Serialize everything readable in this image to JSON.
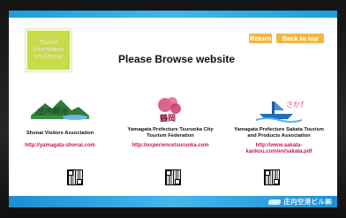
{
  "kiosk": {
    "info_label": "Tourist\nInformation\non Shonai",
    "page_title": "Please Browse website",
    "return_label": "Return",
    "back_to_top_label": "Back to top",
    "footer_text": "庄内空港ビル㈱"
  },
  "organizations": [
    {
      "logo_text": "庄内観光",
      "name": "Shonai Visitors Association",
      "url": "http://yamagata-shonai.com"
    },
    {
      "logo_text": "鶴岡",
      "name": "Yamagata Prefecture Tsuruoka City Tourism Federation",
      "url": "http://experiencetsuruoka.com"
    },
    {
      "logo_text": "さかた",
      "name": "Yamagata Prefecture Sakata Tourism and Products Association",
      "url": "http://www.sakata-kankou.com/en/sakata.pdf"
    }
  ],
  "colors": {
    "accent_blue": "#1a9ee0",
    "info_green": "#c8dc4a",
    "button_orange": "#f2b646",
    "link_red": "#c0204a"
  }
}
